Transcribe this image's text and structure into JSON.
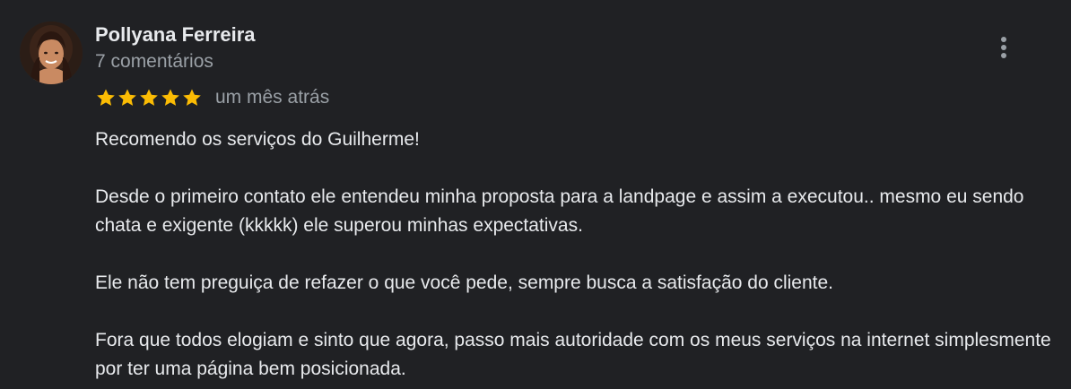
{
  "review": {
    "author_name": "Pollyana Ferreira",
    "author_meta": "7 comentários",
    "rating": 5,
    "rating_max": 5,
    "date": "um mês atrás",
    "paragraphs": [
      "Recomendo os serviços do Guilherme!",
      "Desde o primeiro contato ele entendeu minha proposta para a landpage e assim a executou.. mesmo eu sendo chata e exigente (kkkkk) ele superou minhas expectativas.",
      "Ele não tem preguiça de refazer o que você pede, sempre busca a satisfação do cliente.",
      "Fora que todos elogiam e sinto que agora, passo mais autoridade com os meus serviços na internet simplesmente por ter uma página bem posicionada."
    ]
  },
  "icons": {
    "more": "more-vert-icon",
    "star": "star-icon",
    "avatar": "user-avatar"
  },
  "colors": {
    "background": "#202124",
    "text_primary": "#e8eaed",
    "text_secondary": "#9aa0a6",
    "star": "#fbbc04"
  }
}
